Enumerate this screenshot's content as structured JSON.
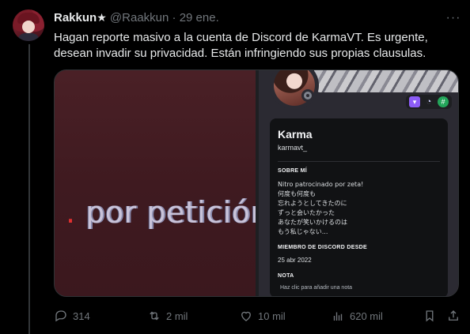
{
  "tweet": {
    "display_name": "Rakkun",
    "star": "★",
    "handle": "@Raakkun",
    "separator": "·",
    "date": "29 ene.",
    "more_label": "···",
    "text": "Hagan reporte masivo a la cuenta de Discord de KarmaVT. Es urgente, desean invadir su privacidad. Están infringiendo sus propias clausulas."
  },
  "media": {
    "left_text_prefix": ".",
    "left_text": " por petición",
    "profile": {
      "name": "Karma",
      "username": "karmavt_",
      "about_heading": "SOBRE MÍ",
      "about_text": "Nitro patrocinado por zeta!\n何度も何度も\n忘れようとしてきたのに\nずっと会いたかった\nあなたが笑いかけるのは\nもう私じゃない...",
      "member_since_heading": "MIEMBRO DE DISCORD DESDE",
      "member_since": "25 abr 2022",
      "note_heading": "NOTA",
      "note_placeholder": "Haz clic para añadir una nota",
      "badges": [
        "nitro-badge",
        "boost-badge",
        "hypesquad-badge"
      ]
    }
  },
  "actions": {
    "replies": "314",
    "reposts": "2 mil",
    "likes": "10 mil",
    "views": "620 mil"
  },
  "colors": {
    "background": "#000000",
    "text": "#e7e9ea",
    "muted": "#71767b",
    "border": "#2f3336",
    "discord_card": "#111214",
    "discord_panel": "#2b2a32",
    "nitro": "#8c5cf6"
  }
}
